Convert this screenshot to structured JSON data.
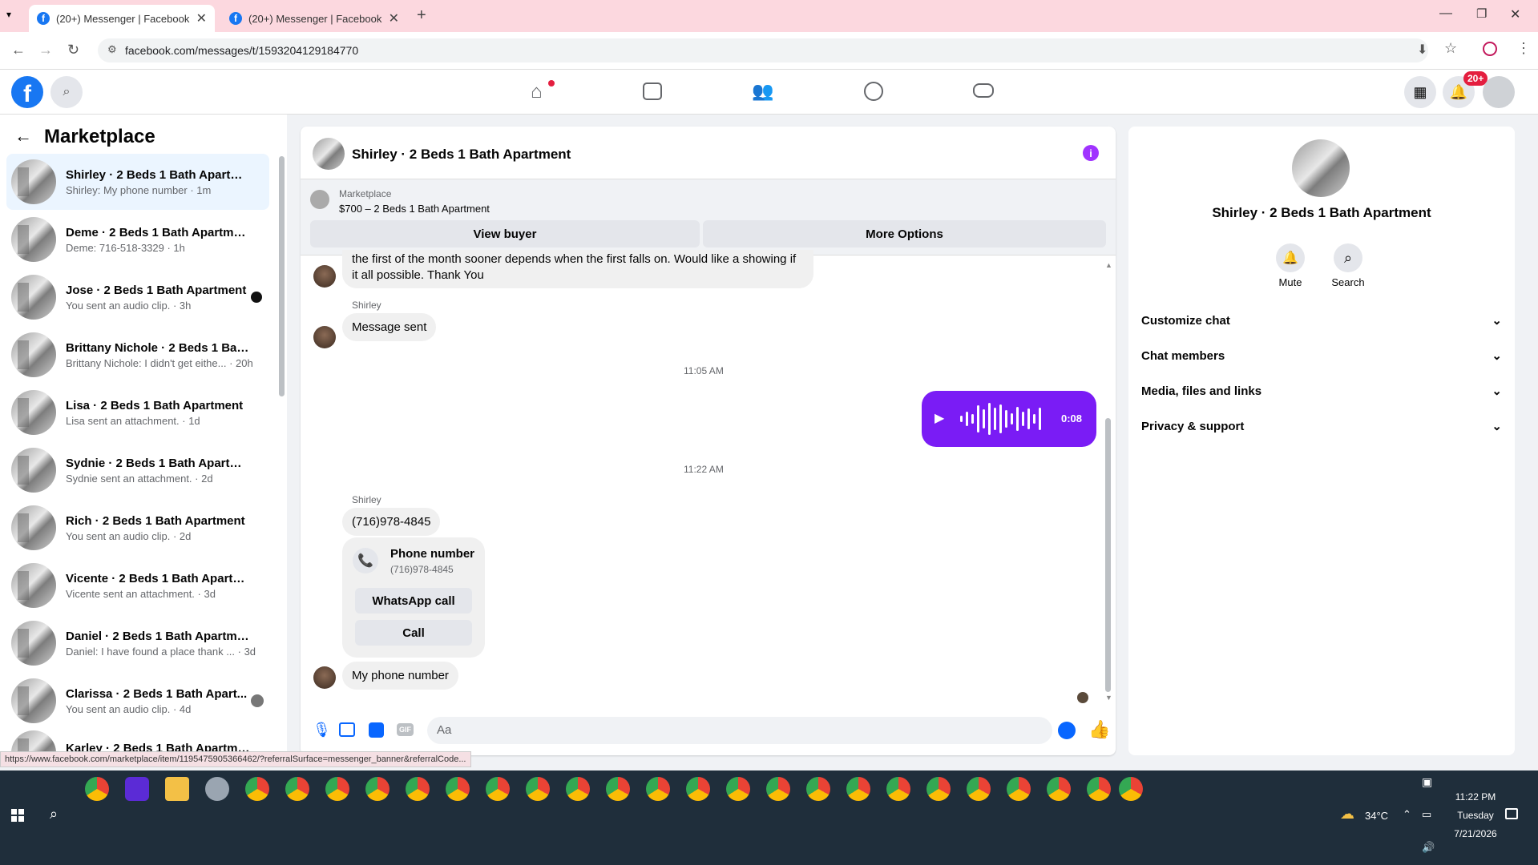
{
  "browser": {
    "tabs": [
      {
        "title": "(20+) Messenger | Facebook"
      },
      {
        "title": "(20+) Messenger | Facebook"
      }
    ],
    "url": "facebook.com/messages/t/1593204129184770",
    "status_url": "https://www.facebook.com/marketplace/item/1195475905366462/?referralSurface=messenger_banner&referralCode..."
  },
  "header": {
    "notif_badge": "20+"
  },
  "sidebar": {
    "title": "Marketplace",
    "items": [
      {
        "title": "Shirley · 2 Beds 1 Bath Apartment",
        "sub": "Shirley: My phone number · 1m"
      },
      {
        "title": "Deme · 2 Beds 1 Bath Apartment",
        "sub": "Deme: 716-518-3329 · 1h"
      },
      {
        "title": "Jose · 2 Beds 1 Bath Apartment",
        "sub": "You sent an audio clip. · 3h"
      },
      {
        "title": "Brittany Nichole · 2 Beds 1 Bath ...",
        "sub": "Brittany Nichole: I didn't get eithe... · 20h"
      },
      {
        "title": "Lisa · 2 Beds 1 Bath Apartment",
        "sub": "Lisa sent an attachment. · 1d"
      },
      {
        "title": "Sydnie · 2 Beds 1 Bath Apartment",
        "sub": "Sydnie sent an attachment. · 2d"
      },
      {
        "title": "Rich · 2 Beds 1 Bath Apartment",
        "sub": "You sent an audio clip. · 2d"
      },
      {
        "title": "Vicente · 2 Beds 1 Bath Apartment",
        "sub": "Vicente sent an attachment. · 3d"
      },
      {
        "title": "Daniel · 2 Beds 1 Bath Apartment",
        "sub": "Daniel: I have found a place thank ... · 3d"
      },
      {
        "title": "Clarissa · 2 Beds 1 Bath Apart...",
        "sub": "You sent an audio clip. · 4d"
      },
      {
        "title": "Karley · 2 Beds 1 Bath Apartment",
        "sub": ""
      }
    ]
  },
  "chat": {
    "title": "Shirley · 2 Beds 1 Bath Apartment",
    "banner_label": "Marketplace",
    "banner_item": "$700 – 2 Beds 1 Bath Apartment",
    "view_buyer": "View buyer",
    "more_options": "More Options",
    "msg_partial": "the first of the month sooner depends when the first falls on. Would like a showing if it all possible. Thank You",
    "sender1": "Shirley",
    "msg_sent": "Message sent",
    "time1": "11:05 AM",
    "audio_duration": "0:08",
    "time2": "11:22 AM",
    "sender2": "Shirley",
    "phone_msg": "(716)978-4845",
    "card_title": "Phone number",
    "card_sub": "(716)978-4845",
    "whatsapp": "WhatsApp call",
    "call": "Call",
    "last_msg": "My phone number",
    "input_placeholder": "Aa"
  },
  "panel": {
    "name": "Shirley · 2 Beds 1 Bath Apartment",
    "mute": "Mute",
    "search": "Search",
    "sections": [
      "Customize chat",
      "Chat members",
      "Media, files and links",
      "Privacy & support"
    ]
  },
  "taskbar": {
    "temp": "34°C",
    "time": "11:22 PM",
    "day": "Tuesday",
    "date": "7/21/2026"
  },
  "colors": {
    "accent": "#a033ff",
    "fb_blue": "#1877f2"
  }
}
